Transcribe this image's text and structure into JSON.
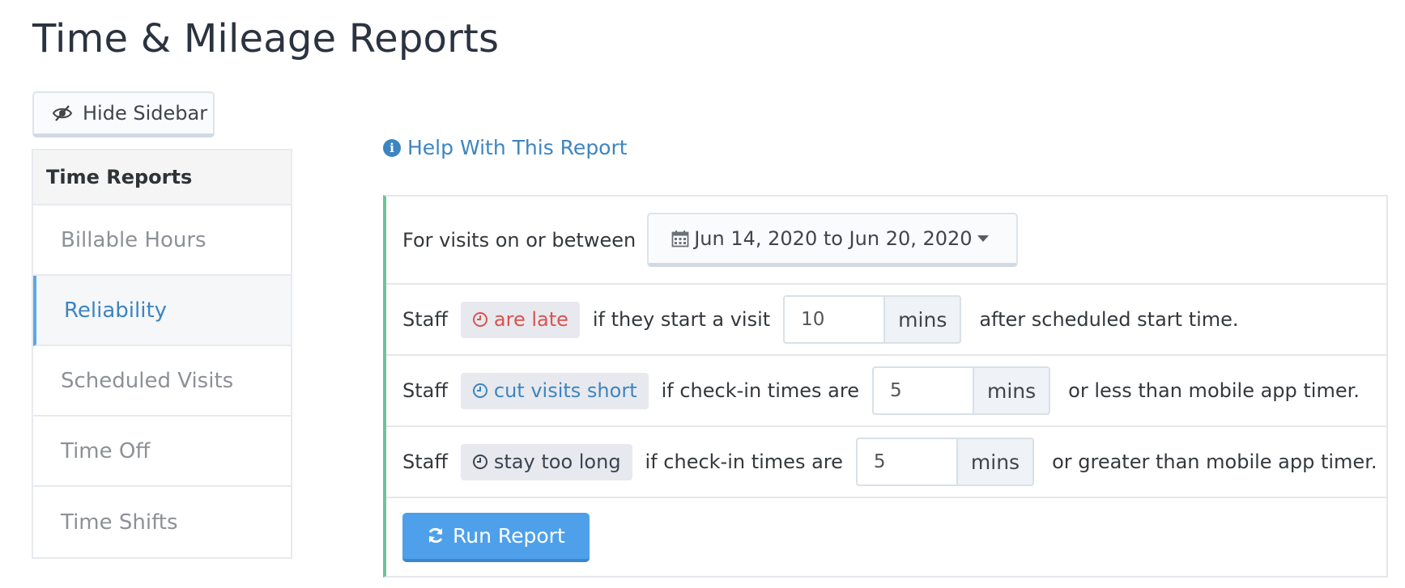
{
  "page": {
    "title": "Time & Mileage Reports"
  },
  "toolbar": {
    "hide_sidebar_label": "Hide Sidebar",
    "hide_sidebar_icon": "eye-slash-icon"
  },
  "sidebar": {
    "header": "Time Reports",
    "items": [
      {
        "label": "Billable Hours",
        "active": false
      },
      {
        "label": "Reliability",
        "active": true
      },
      {
        "label": "Scheduled Visits",
        "active": false
      },
      {
        "label": "Time Off",
        "active": false
      },
      {
        "label": "Time Shifts",
        "active": false
      }
    ]
  },
  "help": {
    "label": "Help With This Report",
    "icon": "info-icon"
  },
  "report": {
    "date_row": {
      "label": "For visits on or between",
      "range": "Jun 14, 2020 to Jun 20, 2020",
      "icon": "calendar-icon"
    },
    "late_row": {
      "staff": "Staff",
      "badge": "are late",
      "condition": "if they start a visit",
      "value": "10",
      "unit": "mins",
      "suffix": "after scheduled start time."
    },
    "short_row": {
      "staff": "Staff",
      "badge": "cut visits short",
      "condition": "if check-in times are",
      "value": "5",
      "unit": "mins",
      "suffix": "or less than mobile app timer."
    },
    "long_row": {
      "staff": "Staff",
      "badge": "stay too long",
      "condition": "if check-in times are",
      "value": "5",
      "unit": "mins",
      "suffix": "or greater than mobile app timer."
    },
    "run_button": {
      "label": "Run Report",
      "icon": "refresh-icon"
    }
  },
  "colors": {
    "accent_blue": "#3d85c0",
    "button_blue": "#4ea0ea",
    "late_red": "#d9534f",
    "panel_border_green": "#6cc39a"
  }
}
